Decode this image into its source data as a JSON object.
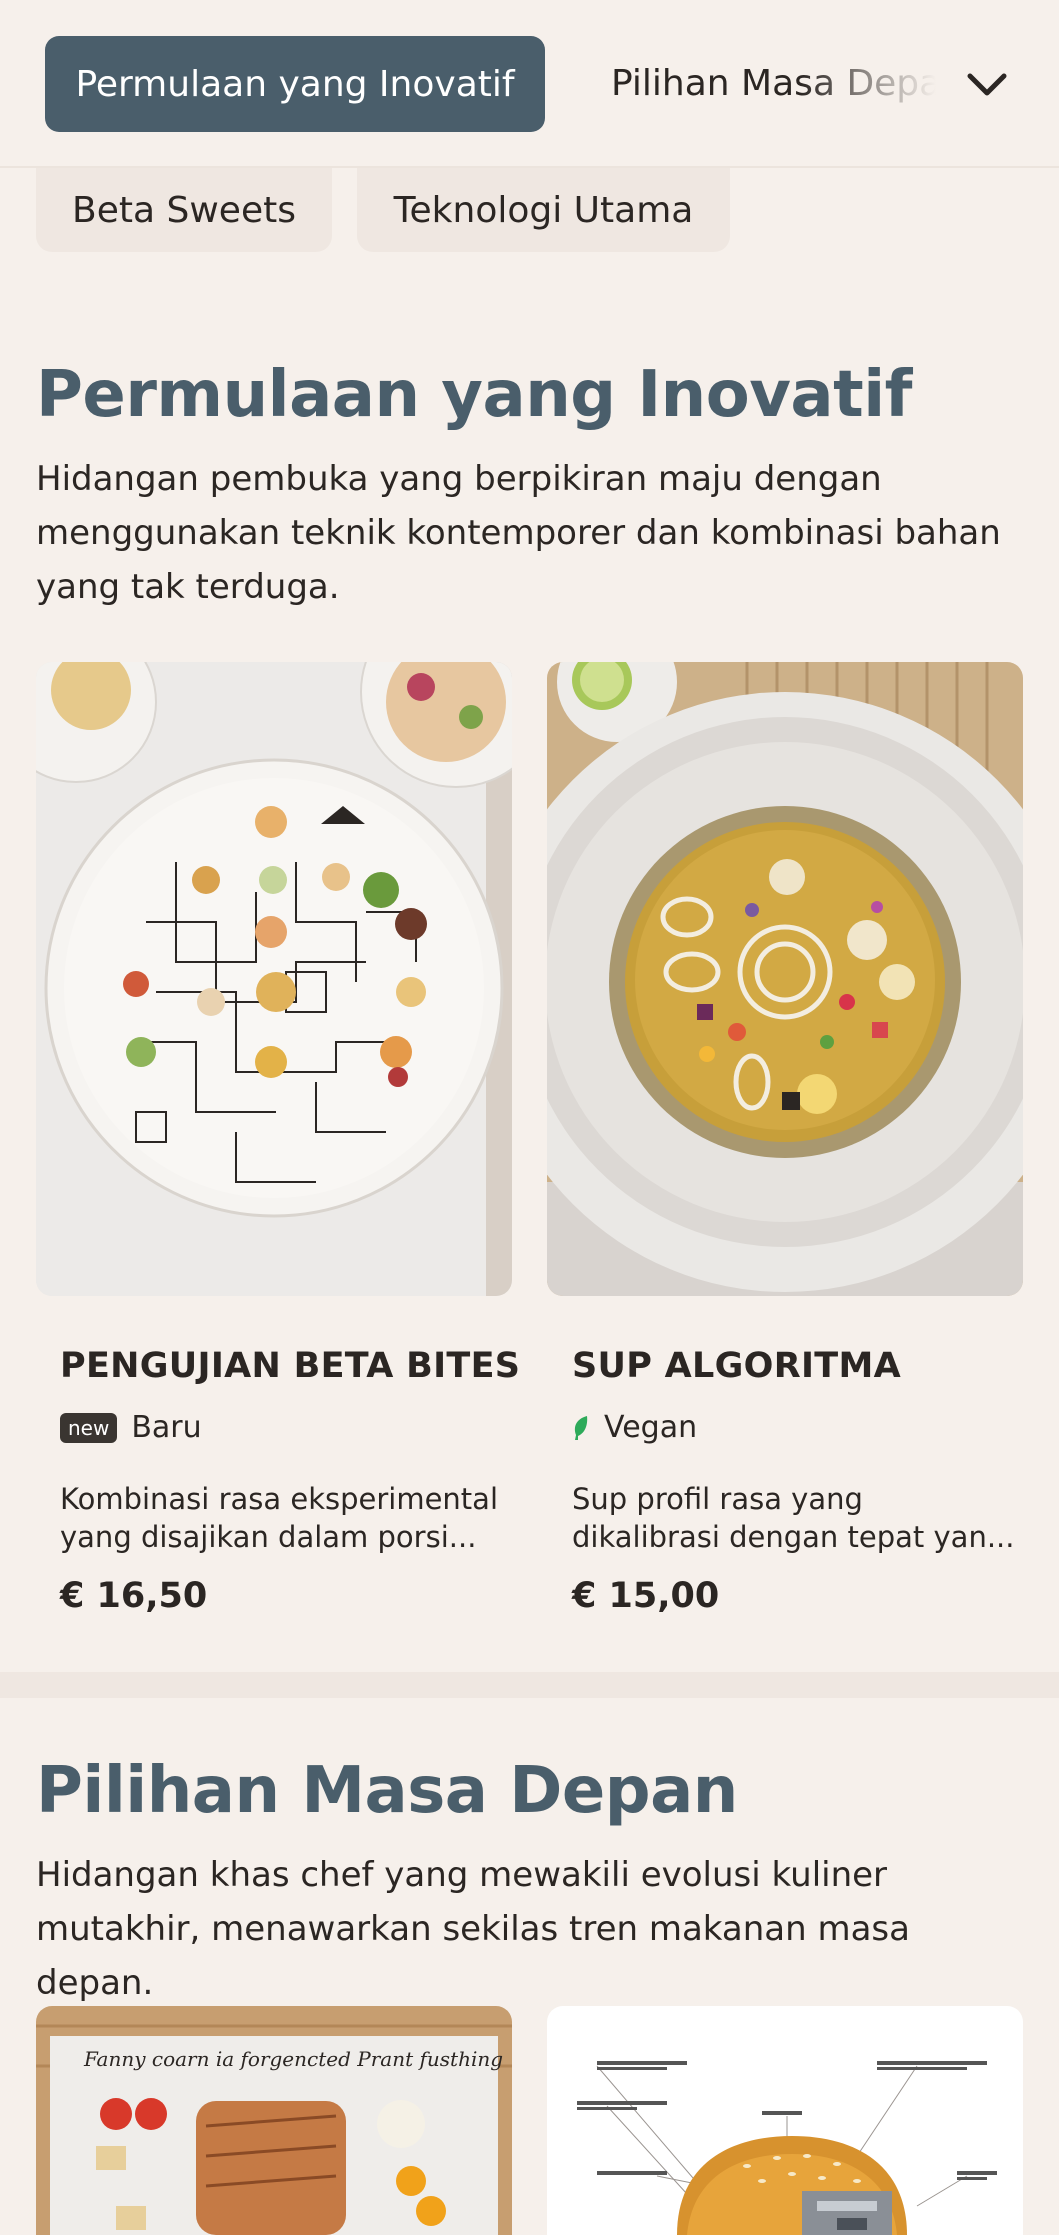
{
  "topbar": {
    "active_tab": "Permulaan yang Inovatif",
    "next_tab": "Pilihan Masa Depan",
    "chevron_icon": "chevron-down-icon"
  },
  "chips": [
    "Beta Sweets",
    "Teknologi Utama"
  ],
  "sections": [
    {
      "title": "Permulaan yang Inovatif",
      "description": "Hidangan pembuka yang berpikiran maju dengan menggunakan teknik kontemporer dan kombinasi bahan yang tak terduga.",
      "items": [
        {
          "name": "PENGUJIAN BETA BITES",
          "badge": "new",
          "tag": "Baru",
          "desc_line1": "Kombinasi rasa eksperimental",
          "desc_line2": "yang disajikan dalam porsi...",
          "price": "€ 16,50"
        },
        {
          "name": "SUP ALGORITMA",
          "tag_icon": "leaf-icon",
          "tag": "Vegan",
          "desc_line1": "Sup profil rasa yang",
          "desc_line2": "dikalibrasi dengan tepat yan...",
          "price": "€ 15,00"
        }
      ]
    },
    {
      "title": "Pilihan Masa Depan",
      "description": "Hidangan khas chef yang mewakili evolusi kuliner mutakhir, menawarkan sekilas tren makanan masa depan.",
      "items": [
        {
          "image_caption": "Fanny coarn ia forgencted Prant fusthing"
        },
        {
          "image_caption": ""
        }
      ]
    }
  ],
  "colors": {
    "background": "#f6f0eb",
    "accent": "#4a5e6b",
    "vegan_green": "#2eaa5a"
  }
}
